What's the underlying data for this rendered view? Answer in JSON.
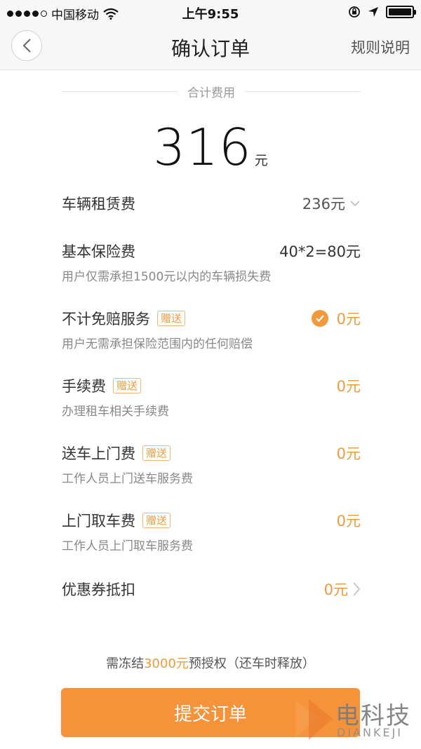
{
  "status_bar": {
    "carrier": "中国移动",
    "time": "上午9:55"
  },
  "nav": {
    "title": "确认订单",
    "rule_link": "规则说明"
  },
  "summary": {
    "label": "合计费用",
    "amount": "316",
    "unit": "元"
  },
  "fees": [
    {
      "name": "车辆租赁费",
      "value": "236元",
      "desc": "",
      "badge": ""
    },
    {
      "name": "基本保险费",
      "value": "40*2=80元",
      "desc": "用户仅需承担1500元以内的车辆损失费",
      "badge": ""
    },
    {
      "name": "不计免赔服务",
      "value": "0元",
      "desc": "用户无需承担保险范围内的任何赔偿",
      "badge": "赠送"
    },
    {
      "name": "手续费",
      "value": "0元",
      "desc": "办理租车相关手续费",
      "badge": "赠送"
    },
    {
      "name": "送车上门费",
      "value": "0元",
      "desc": "工作人员上门送车服务费",
      "badge": "赠送"
    },
    {
      "name": "上门取车费",
      "value": "0元",
      "desc": "工作人员上门取车服务费",
      "badge": "赠送"
    },
    {
      "name": "优惠券抵扣",
      "value": "0元",
      "desc": "",
      "badge": ""
    }
  ],
  "notice": {
    "prefix": "需冻结",
    "amount": "3000元",
    "suffix": "预授权（还车时释放）"
  },
  "submit_label": "提交订单",
  "watermark": {
    "cn": "电科技",
    "en": "DIANKEJI"
  },
  "colors": {
    "accent": "#f6923a",
    "badge": "#f29a3b"
  }
}
